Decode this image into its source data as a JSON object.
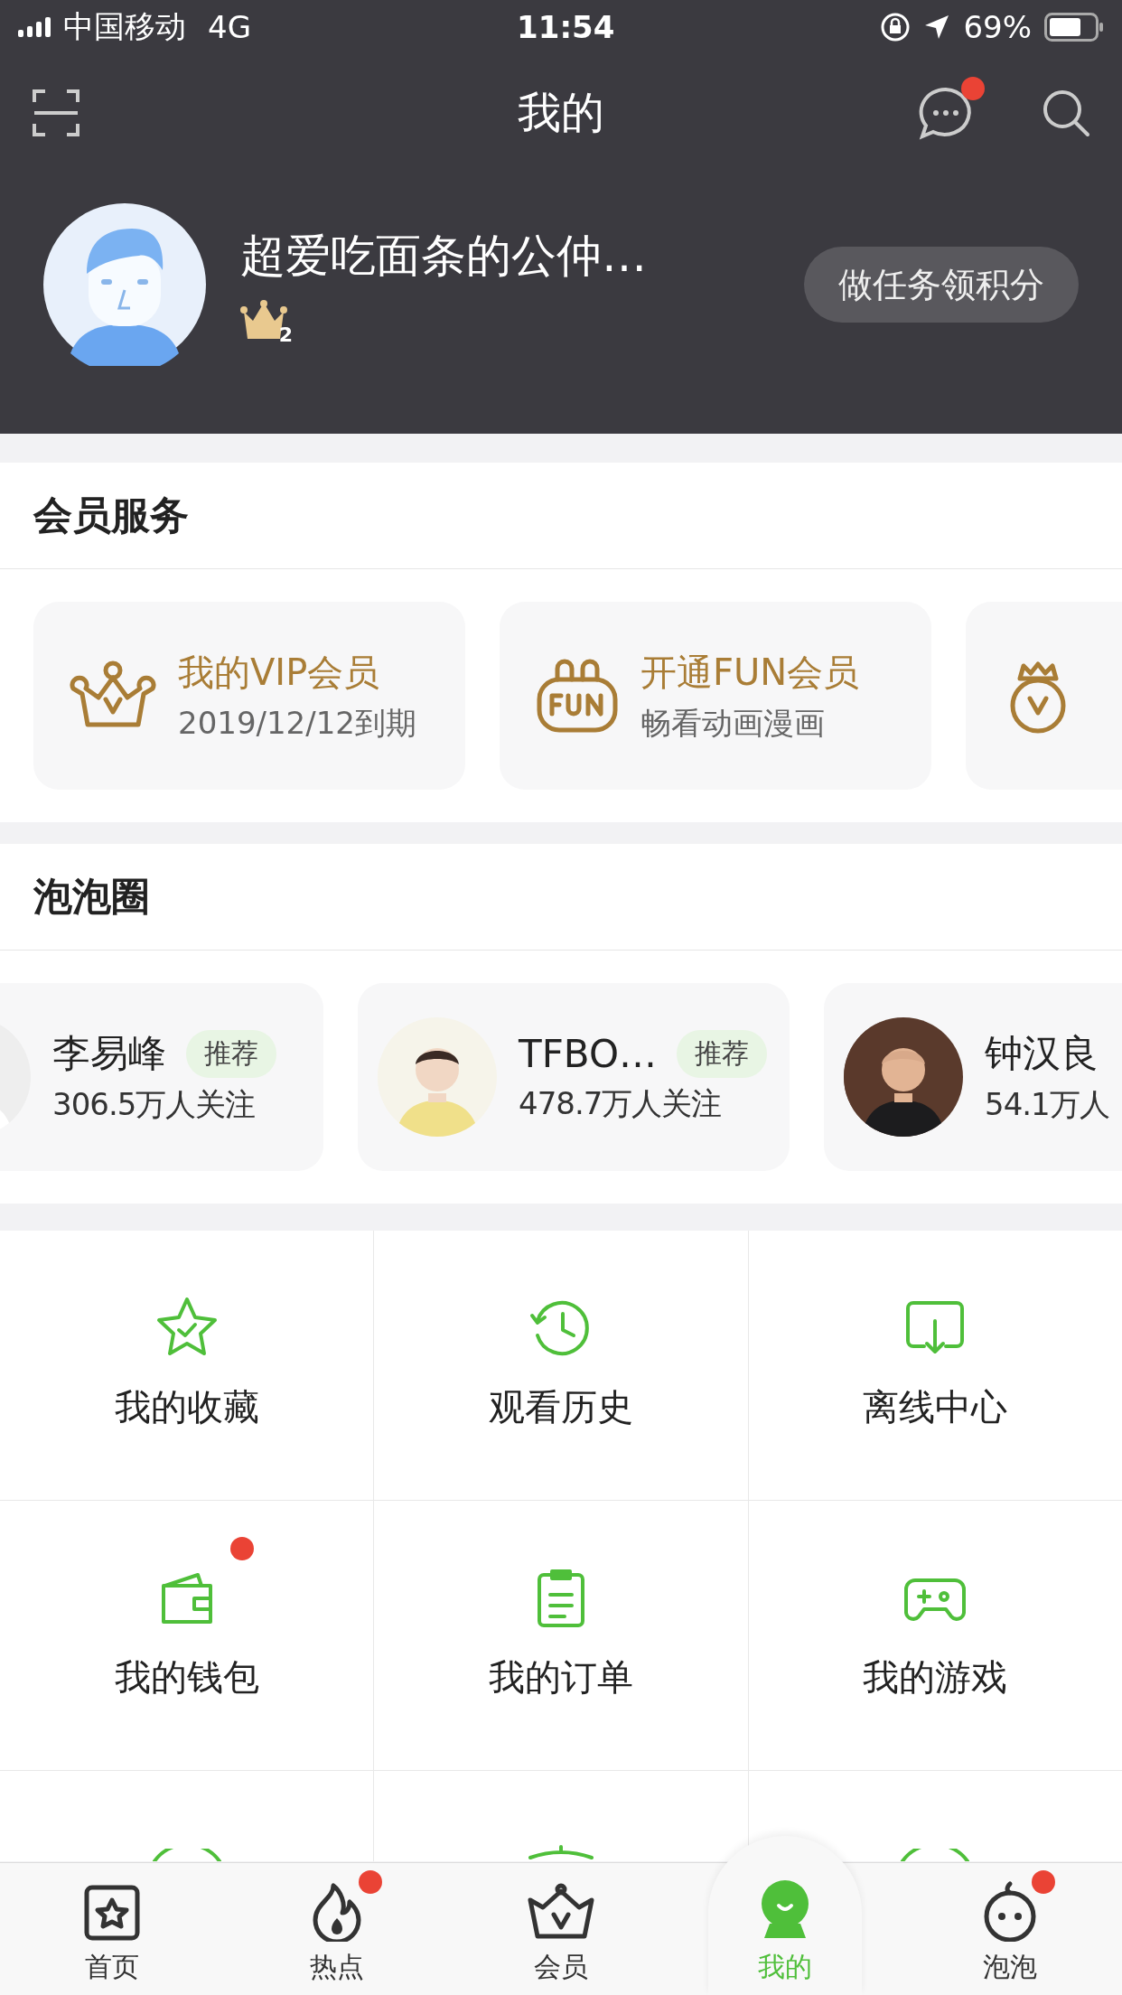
{
  "status_bar": {
    "carrier": "中国移动",
    "network": "4G",
    "time": "11:54",
    "battery": "69%"
  },
  "header": {
    "title": "我的",
    "messages_badge": true
  },
  "profile": {
    "name": "超爱吃面条的公仲…",
    "level": "2",
    "task_button": "做任务领积分"
  },
  "member_services": {
    "title": "会员服务",
    "cards": [
      {
        "kind": "crown",
        "title": "我的VIP会员",
        "subtitle": "2019/12/12到期"
      },
      {
        "kind": "fun",
        "title": "开通FUN会员",
        "subtitle": "畅看动画漫画"
      },
      {
        "kind": "medal"
      }
    ]
  },
  "bubble_circle": {
    "title": "泡泡圈",
    "cards": [
      {
        "name": "李易峰",
        "followers": "306.5万人关注",
        "tag": "推荐"
      },
      {
        "name": "TFBO…",
        "followers": "478.7万人关注",
        "tag": "推荐"
      },
      {
        "name": "钟汉良",
        "followers": "54.1万人"
      }
    ]
  },
  "grid": [
    {
      "kind": "star",
      "label": "我的收藏",
      "badge": false
    },
    {
      "kind": "history",
      "label": "观看历史",
      "badge": false
    },
    {
      "kind": "download",
      "label": "离线中心",
      "badge": false
    },
    {
      "kind": "wallet",
      "label": "我的钱包",
      "badge": true
    },
    {
      "kind": "order",
      "label": "我的订单",
      "badge": false
    },
    {
      "kind": "game",
      "label": "我的游戏",
      "badge": false
    },
    {
      "kind": "ring"
    },
    {
      "kind": "alarm"
    },
    {
      "kind": "ring"
    }
  ],
  "tabs": [
    {
      "kind": "home",
      "label": "首页",
      "selected": false,
      "badge": false
    },
    {
      "kind": "fire",
      "label": "热点",
      "selected": false,
      "badge": true
    },
    {
      "kind": "vip",
      "label": "会员",
      "selected": false,
      "badge": false
    },
    {
      "kind": "me",
      "label": "我的",
      "selected": true,
      "badge": false
    },
    {
      "kind": "bubble",
      "label": "泡泡",
      "selected": false,
      "badge": true
    }
  ]
}
